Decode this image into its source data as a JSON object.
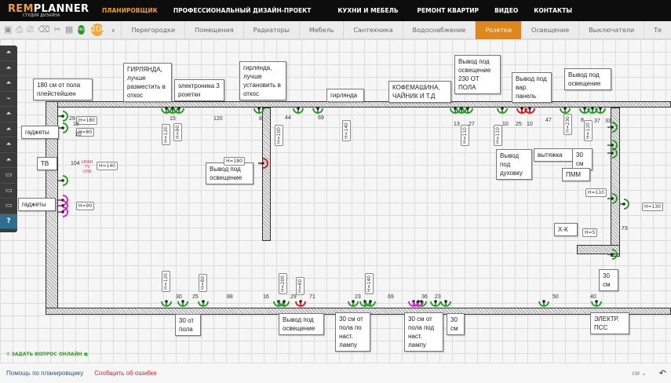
{
  "logo": {
    "brand_a": "REM",
    "brand_b": "PLANNER",
    "subtitle": "СТУДИЯ ДИЗАЙНА"
  },
  "topnav": [
    "ПЛАНИРОВЩИК",
    "ПРОФЕССИОНАЛЬНЫЙ ДИЗАЙН-ПРОЕКТ",
    "КУХНИ И МЕБЕЛЬ",
    "РЕМОНТ КВАРТИР",
    "ВИДЕО",
    "КОНТАКТЫ"
  ],
  "accent": "#f0a020",
  "toolbar": {
    "pro": "PRO",
    "mode_2d": "2D",
    "mode_3d": "3D",
    "tabs": [
      "Перегородки",
      "Помещения",
      "Радиаторы",
      "Мебель",
      "Сантехника",
      "Водоснабжение",
      "Розетки",
      "Освещение",
      "Выключатели",
      "Те"
    ],
    "active_tab": "Розетки"
  },
  "tools": {
    "help": "?"
  },
  "labels": [
    "180 см от пола плейстейшен",
    "ГИРЛЯНДА, лучше разместить в откос",
    "электроника 3 розетки",
    "гирлянда, лучше установить в откос",
    "гаджеты",
    "ТВ",
    "гаджеты",
    "Вывод под освещение",
    "гирлянда",
    "КОФЕМАШИНА, ЧАЙНИК И Т.Д",
    "Вывод под освещение 230 ОТ ПОЛА",
    "Вывод под вар. панель",
    "Вывод под освещение",
    "Вывод под духовку",
    "вытяжка",
    "30 см",
    "ПММ",
    "Х-К",
    "30 см",
    "ЭЛЕКТР. ПСС",
    "30 от пола",
    "Вывод под освещение",
    "30 см от пола по наст. лампу",
    "30 см от пола под наст. лампу",
    "30 см"
  ],
  "tags": [
    "H=180",
    "H=80",
    "H=140",
    "H=90",
    "H=180",
    "H=110",
    "H=130",
    "H=5",
    "H=120",
    "H=90",
    "H=100",
    "H=140",
    "H=110",
    "H=110",
    "H=230",
    "H=120",
    "H=120",
    "H=80",
    "H=200",
    "H=60",
    "H=140"
  ],
  "dims": [
    "29",
    "15",
    "120",
    "8",
    "44",
    "69",
    "13",
    "27",
    "10",
    "25",
    "10",
    "47",
    "8",
    "37",
    "33",
    "30",
    "25",
    "88",
    "16",
    "29",
    "71",
    "23",
    "69",
    "36",
    "23",
    "50",
    "40",
    "104",
    "20",
    "18",
    "73"
  ],
  "tv_label": "HDMI TV USB",
  "ask": "ЗАДАТЬ ВОПРОС ОНЛАЙН",
  "bottom": {
    "help": "Помощь по планировщику",
    "report": "Сообщить об ошибке",
    "unit": "см"
  }
}
